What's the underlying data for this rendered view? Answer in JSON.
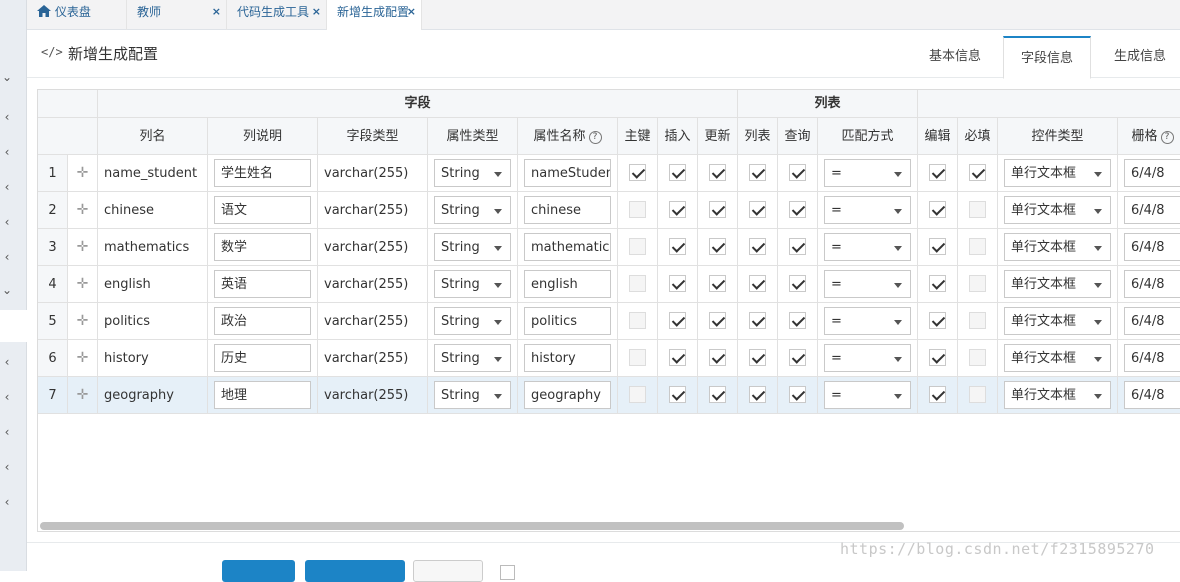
{
  "tabs": [
    {
      "label": "仪表盘",
      "icon": "home-icon",
      "closable": false
    },
    {
      "label": "教师",
      "closable": true
    },
    {
      "label": "代码生成工具",
      "closable": true
    },
    {
      "label": "新增生成配置",
      "closable": true,
      "active": true
    }
  ],
  "tab_close_glyph": "×",
  "page": {
    "title": "新增生成配置",
    "icon": "code-icon"
  },
  "subtabs": [
    {
      "label": "基本信息"
    },
    {
      "label": "字段信息",
      "active": true
    },
    {
      "label": "生成信息"
    }
  ],
  "grid": {
    "groups": {
      "field": "字段",
      "list": "列表"
    },
    "headers": {
      "col_name": "列名",
      "col_desc": "列说明",
      "field_type": "字段类型",
      "attr_type": "属性类型",
      "attr_name": "属性名称",
      "pk": "主键",
      "insert": "插入",
      "update": "更新",
      "list": "列表",
      "query": "查询",
      "match": "匹配方式",
      "edit": "编辑",
      "required": "必填",
      "control": "控件类型",
      "grid_size": "栅格"
    },
    "rows": [
      {
        "num": "1",
        "col_name": "name_student",
        "desc": "学生姓名",
        "field_type": "varchar(255)",
        "attr_type": "String",
        "attr_name": "nameStudent",
        "pk": true,
        "insert": true,
        "update": true,
        "list": true,
        "query": true,
        "match": "=",
        "edit": true,
        "required": true,
        "control": "单行文本框",
        "grid_size": "6/4/8"
      },
      {
        "num": "2",
        "col_name": "chinese",
        "desc": "语文",
        "field_type": "varchar(255)",
        "attr_type": "String",
        "attr_name": "chinese",
        "pk": false,
        "insert": true,
        "update": true,
        "list": true,
        "query": true,
        "match": "=",
        "edit": true,
        "required": false,
        "control": "单行文本框",
        "grid_size": "6/4/8"
      },
      {
        "num": "3",
        "col_name": "mathematics",
        "desc": "数学",
        "field_type": "varchar(255)",
        "attr_type": "String",
        "attr_name": "mathematics",
        "pk": false,
        "insert": true,
        "update": true,
        "list": true,
        "query": true,
        "match": "=",
        "edit": true,
        "required": false,
        "control": "单行文本框",
        "grid_size": "6/4/8"
      },
      {
        "num": "4",
        "col_name": "english",
        "desc": "英语",
        "field_type": "varchar(255)",
        "attr_type": "String",
        "attr_name": "english",
        "pk": false,
        "insert": true,
        "update": true,
        "list": true,
        "query": true,
        "match": "=",
        "edit": true,
        "required": false,
        "control": "单行文本框",
        "grid_size": "6/4/8"
      },
      {
        "num": "5",
        "col_name": "politics",
        "desc": "政治",
        "field_type": "varchar(255)",
        "attr_type": "String",
        "attr_name": "politics",
        "pk": false,
        "insert": true,
        "update": true,
        "list": true,
        "query": true,
        "match": "=",
        "edit": true,
        "required": false,
        "control": "单行文本框",
        "grid_size": "6/4/8"
      },
      {
        "num": "6",
        "col_name": "history",
        "desc": "历史",
        "field_type": "varchar(255)",
        "attr_type": "String",
        "attr_name": "history",
        "pk": false,
        "insert": true,
        "update": true,
        "list": true,
        "query": true,
        "match": "=",
        "edit": true,
        "required": false,
        "control": "单行文本框",
        "grid_size": "6/4/8"
      },
      {
        "num": "7",
        "col_name": "geography",
        "desc": "地理",
        "field_type": "varchar(255)",
        "attr_type": "String",
        "attr_name": "geography",
        "pk": false,
        "insert": true,
        "update": true,
        "list": true,
        "query": true,
        "match": "=",
        "edit": true,
        "required": false,
        "control": "单行文本框",
        "grid_size": "6/4/8",
        "selected": true
      }
    ]
  },
  "watermark": "https://blog.csdn.net/f2315895270"
}
